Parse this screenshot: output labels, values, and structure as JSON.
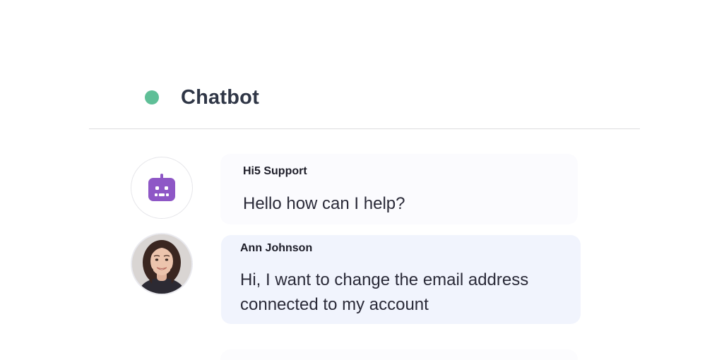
{
  "header": {
    "title": "Chatbot",
    "status_color": "#5fbf97"
  },
  "messages": [
    {
      "sender": "Hi5 Support",
      "text": "Hello how can I help?",
      "avatar_icon": "robot-icon",
      "avatar_color": "#8e57c6"
    },
    {
      "sender": "Ann Johnson",
      "text": "Hi, I want to change the email address connected to my account",
      "avatar_icon": "user-photo"
    }
  ],
  "colors": {
    "bot_bubble": "#fbfbfe",
    "user_bubble": "#f1f4fd",
    "title_text": "#2f3646"
  }
}
